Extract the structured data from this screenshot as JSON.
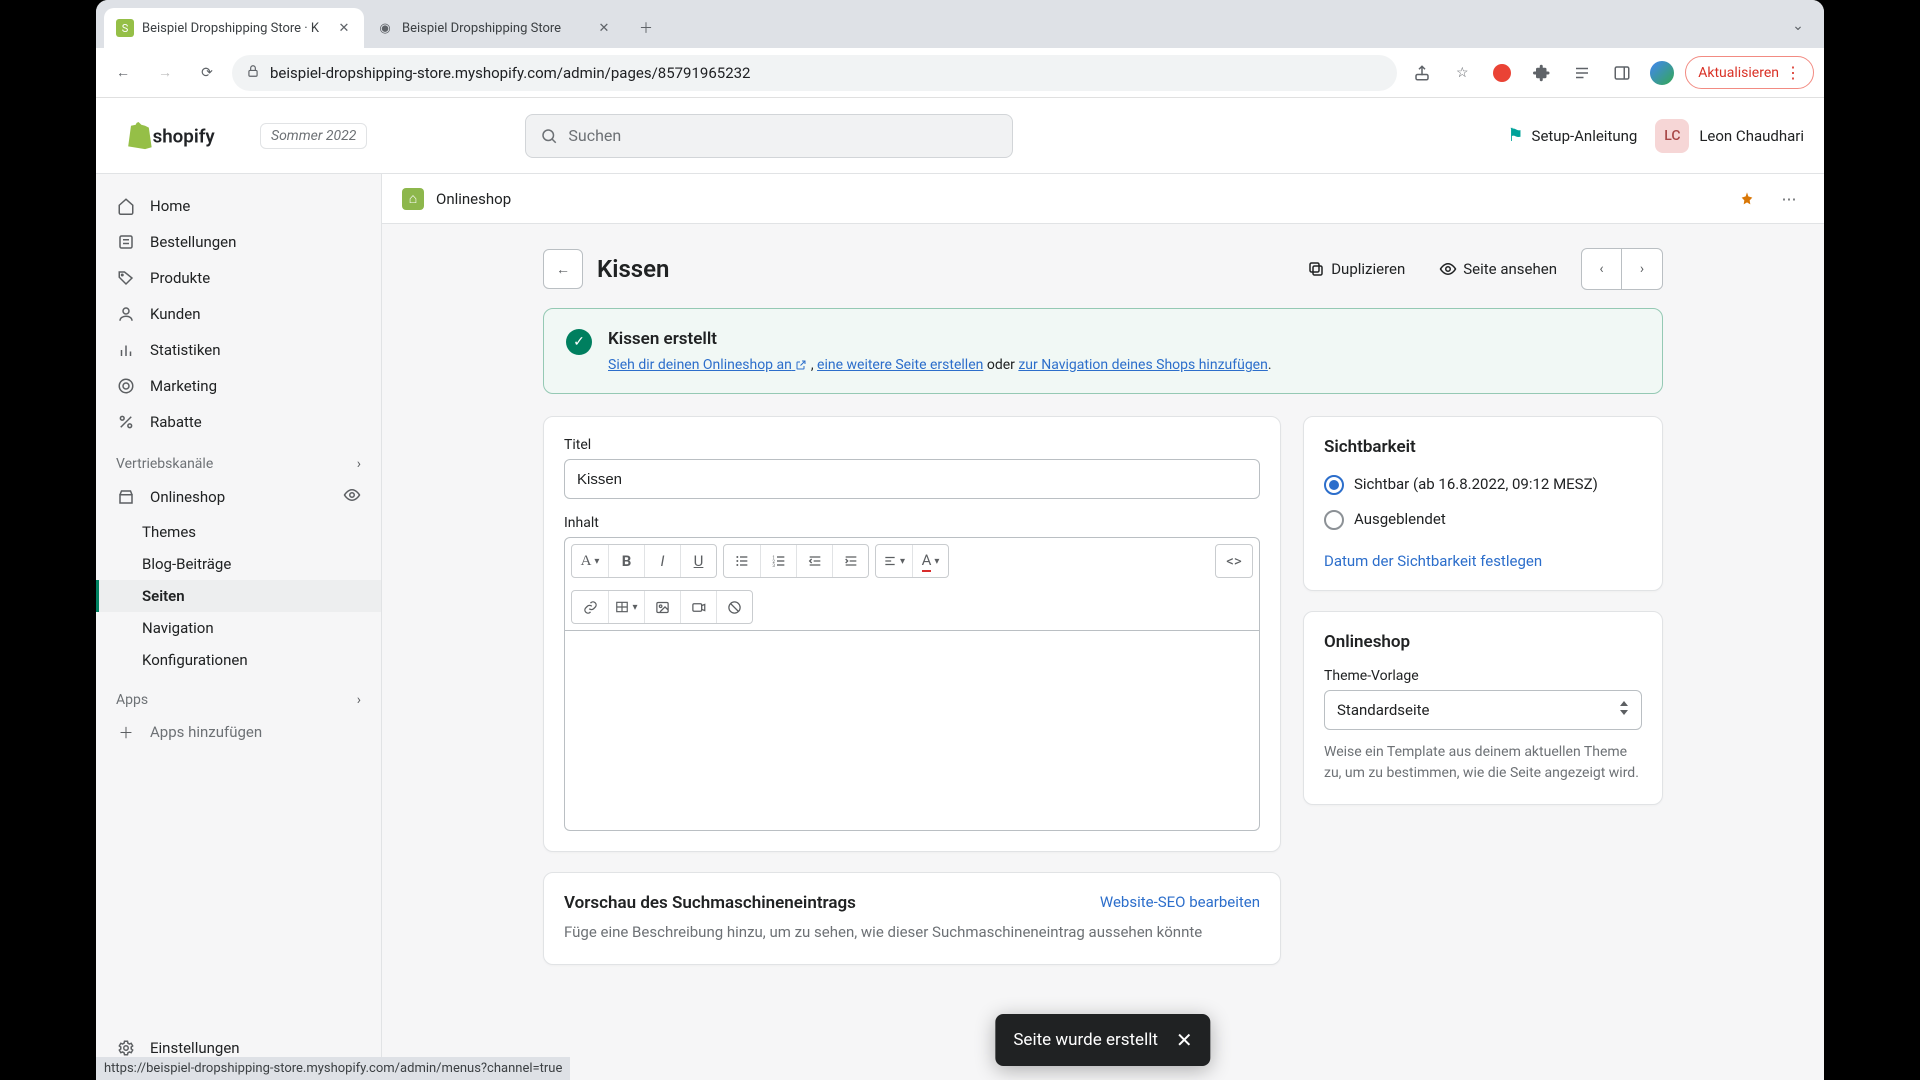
{
  "browser": {
    "tabs": [
      {
        "title": "Beispiel Dropshipping Store · K",
        "favicon": "shopify"
      },
      {
        "title": "Beispiel Dropshipping Store",
        "favicon": "globe"
      }
    ],
    "url": "beispiel-dropshipping-store.myshopify.com/admin/pages/85791965232",
    "update_pill": "Aktualisieren",
    "status_link": "https://beispiel-dropshipping-store.myshopify.com/admin/menus?channel=true"
  },
  "topbar": {
    "season": "Sommer 2022",
    "search_placeholder": "Suchen",
    "setup": "Setup-Anleitung",
    "user_initials": "LC",
    "user_name": "Leon Chaudhari"
  },
  "sidebar": {
    "items": [
      {
        "label": "Home",
        "icon": "home"
      },
      {
        "label": "Bestellungen",
        "icon": "orders"
      },
      {
        "label": "Produkte",
        "icon": "products"
      },
      {
        "label": "Kunden",
        "icon": "customers"
      },
      {
        "label": "Statistiken",
        "icon": "analytics"
      },
      {
        "label": "Marketing",
        "icon": "marketing"
      },
      {
        "label": "Rabatte",
        "icon": "discounts"
      }
    ],
    "channels_label": "Vertriebskanäle",
    "onlineshop": {
      "label": "Onlineshop",
      "sub": [
        {
          "label": "Themes"
        },
        {
          "label": "Blog-Beiträge"
        },
        {
          "label": "Seiten",
          "active": true
        },
        {
          "label": "Navigation"
        },
        {
          "label": "Konfigurationen"
        }
      ]
    },
    "apps_label": "Apps",
    "apps_add": "Apps hinzufügen",
    "settings": "Einstellungen"
  },
  "crumb": {
    "label": "Onlineshop"
  },
  "page": {
    "title": "Kissen",
    "duplicate": "Duplizieren",
    "view": "Seite ansehen"
  },
  "banner": {
    "title": "Kissen erstellt",
    "link1": "Sieh dir deinen Onlineshop an",
    "link2": "eine weitere Seite erstellen",
    "text_mid": " oder ",
    "link3": "zur Navigation deines Shops hinzufügen",
    "sep": " , "
  },
  "form": {
    "title_label": "Titel",
    "title_value": "Kissen",
    "content_label": "Inhalt"
  },
  "seo": {
    "title": "Vorschau des Suchmaschineneintrags",
    "edit": "Website-SEO bearbeiten",
    "desc": "Füge eine Beschreibung hinzu, um zu sehen, wie dieser Suchmaschineneintrag aussehen könnte"
  },
  "visibility": {
    "title": "Sichtbarkeit",
    "visible": "Sichtbar (ab 16.8.2022, 09:12 MESZ)",
    "hidden": "Ausgeblendet",
    "schedule": "Datum der Sichtbarkeit festlegen"
  },
  "onlineshop_card": {
    "title": "Onlineshop",
    "template_label": "Theme-Vorlage",
    "template_value": "Standardseite",
    "help": "Weise ein Template aus deinem aktuellen Theme zu, um zu bestimmen, wie die Seite angezeigt wird."
  },
  "toast": "Seite wurde erstellt"
}
